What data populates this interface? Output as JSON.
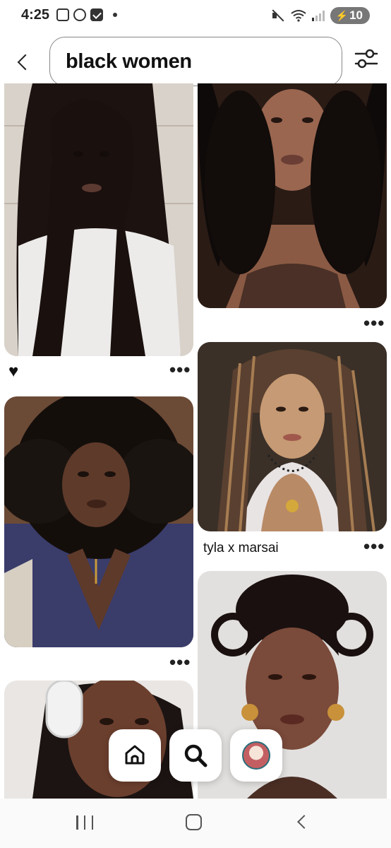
{
  "status_bar": {
    "time": "4:25",
    "battery_level": "10",
    "icons": [
      "screenshot-icon",
      "face-id-icon",
      "check-icon",
      "notification-dot",
      "mute-icon",
      "wifi-icon",
      "signal-icon",
      "battery-charging-icon"
    ]
  },
  "header": {
    "back_icon": "chevron-left-icon",
    "search_query": "black women",
    "filter_icon": "sliders-icon"
  },
  "pins": [
    {
      "title": "",
      "saved_icon": "heart-icon",
      "more_label": "•••",
      "colors": [
        "#3b2a22",
        "#1c1210",
        "#e8e2dc"
      ]
    },
    {
      "title": "",
      "more_label": "•••",
      "colors": [
        "#2a1b15",
        "#0e0a09",
        "#8a5a44"
      ]
    },
    {
      "title": "",
      "more_label": "•••",
      "colors": [
        "#1a1410",
        "#3a3c6a",
        "#6b4a36"
      ]
    },
    {
      "title": "tyla x marsai",
      "more_label": "•••",
      "colors": [
        "#4a3a2e",
        "#c69a74",
        "#e9e4e4"
      ]
    },
    {
      "title": "",
      "more_label": "",
      "colors": [
        "#e9e6e4",
        "#1c1412",
        "#6b3f2e"
      ]
    },
    {
      "title": "",
      "more_label": "",
      "colors": [
        "#e2e0de",
        "#1a1010",
        "#7a4a3a"
      ]
    }
  ],
  "bottom_nav": {
    "items": [
      "home-icon",
      "search-icon",
      "profile-avatar"
    ]
  },
  "system_nav": {
    "items": [
      "recent-apps-icon",
      "home-circle-icon",
      "back-icon"
    ]
  }
}
